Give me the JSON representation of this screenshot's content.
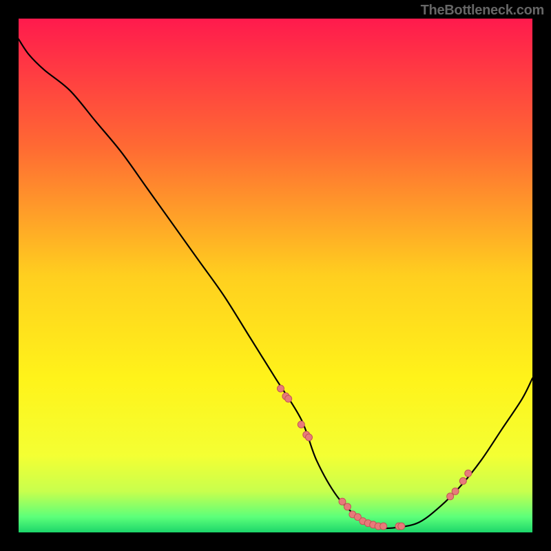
{
  "attribution": "TheBottleneck.com",
  "chart_data": {
    "type": "line",
    "title": "",
    "xlabel": "",
    "ylabel": "",
    "xlim": [
      0,
      100
    ],
    "ylim": [
      0,
      100
    ],
    "grid": false,
    "legend": false,
    "background_gradient_stops": [
      {
        "offset": 0.0,
        "color": "#ff1a4d"
      },
      {
        "offset": 0.25,
        "color": "#ff6a33"
      },
      {
        "offset": 0.5,
        "color": "#ffcf1f"
      },
      {
        "offset": 0.7,
        "color": "#fff31a"
      },
      {
        "offset": 0.85,
        "color": "#f4ff33"
      },
      {
        "offset": 0.92,
        "color": "#c8ff4d"
      },
      {
        "offset": 0.97,
        "color": "#5cff7a"
      },
      {
        "offset": 1.0,
        "color": "#1cd66a"
      }
    ],
    "series": [
      {
        "name": "bottleneck-curve",
        "type": "spline",
        "color": "#000000",
        "width": 2.2,
        "x": [
          0,
          2,
          5,
          10,
          15,
          20,
          25,
          30,
          35,
          40,
          45,
          50,
          55,
          58,
          62,
          66,
          70,
          74,
          78,
          82,
          86,
          90,
          94,
          98,
          100
        ],
        "y": [
          96,
          93,
          90,
          86,
          80,
          74,
          67,
          60,
          53,
          46,
          38,
          30,
          22,
          14,
          7,
          3,
          1,
          1,
          2,
          5,
          9,
          14,
          20,
          26,
          30
        ]
      },
      {
        "name": "data-points",
        "type": "scatter",
        "color": "#e77a7a",
        "stroke": "#c25555",
        "radius": 5,
        "x": [
          51,
          52,
          52.5,
          55,
          56,
          56.5,
          63,
          64,
          65,
          66,
          67,
          68,
          69,
          70,
          71,
          74,
          74.5,
          84,
          85,
          86.5,
          87.5
        ],
        "y": [
          28,
          26.5,
          26,
          21,
          19,
          18.5,
          6,
          5,
          3.5,
          3,
          2.2,
          1.8,
          1.5,
          1.2,
          1.2,
          1.2,
          1.2,
          7,
          8,
          10,
          11.5
        ]
      }
    ]
  }
}
